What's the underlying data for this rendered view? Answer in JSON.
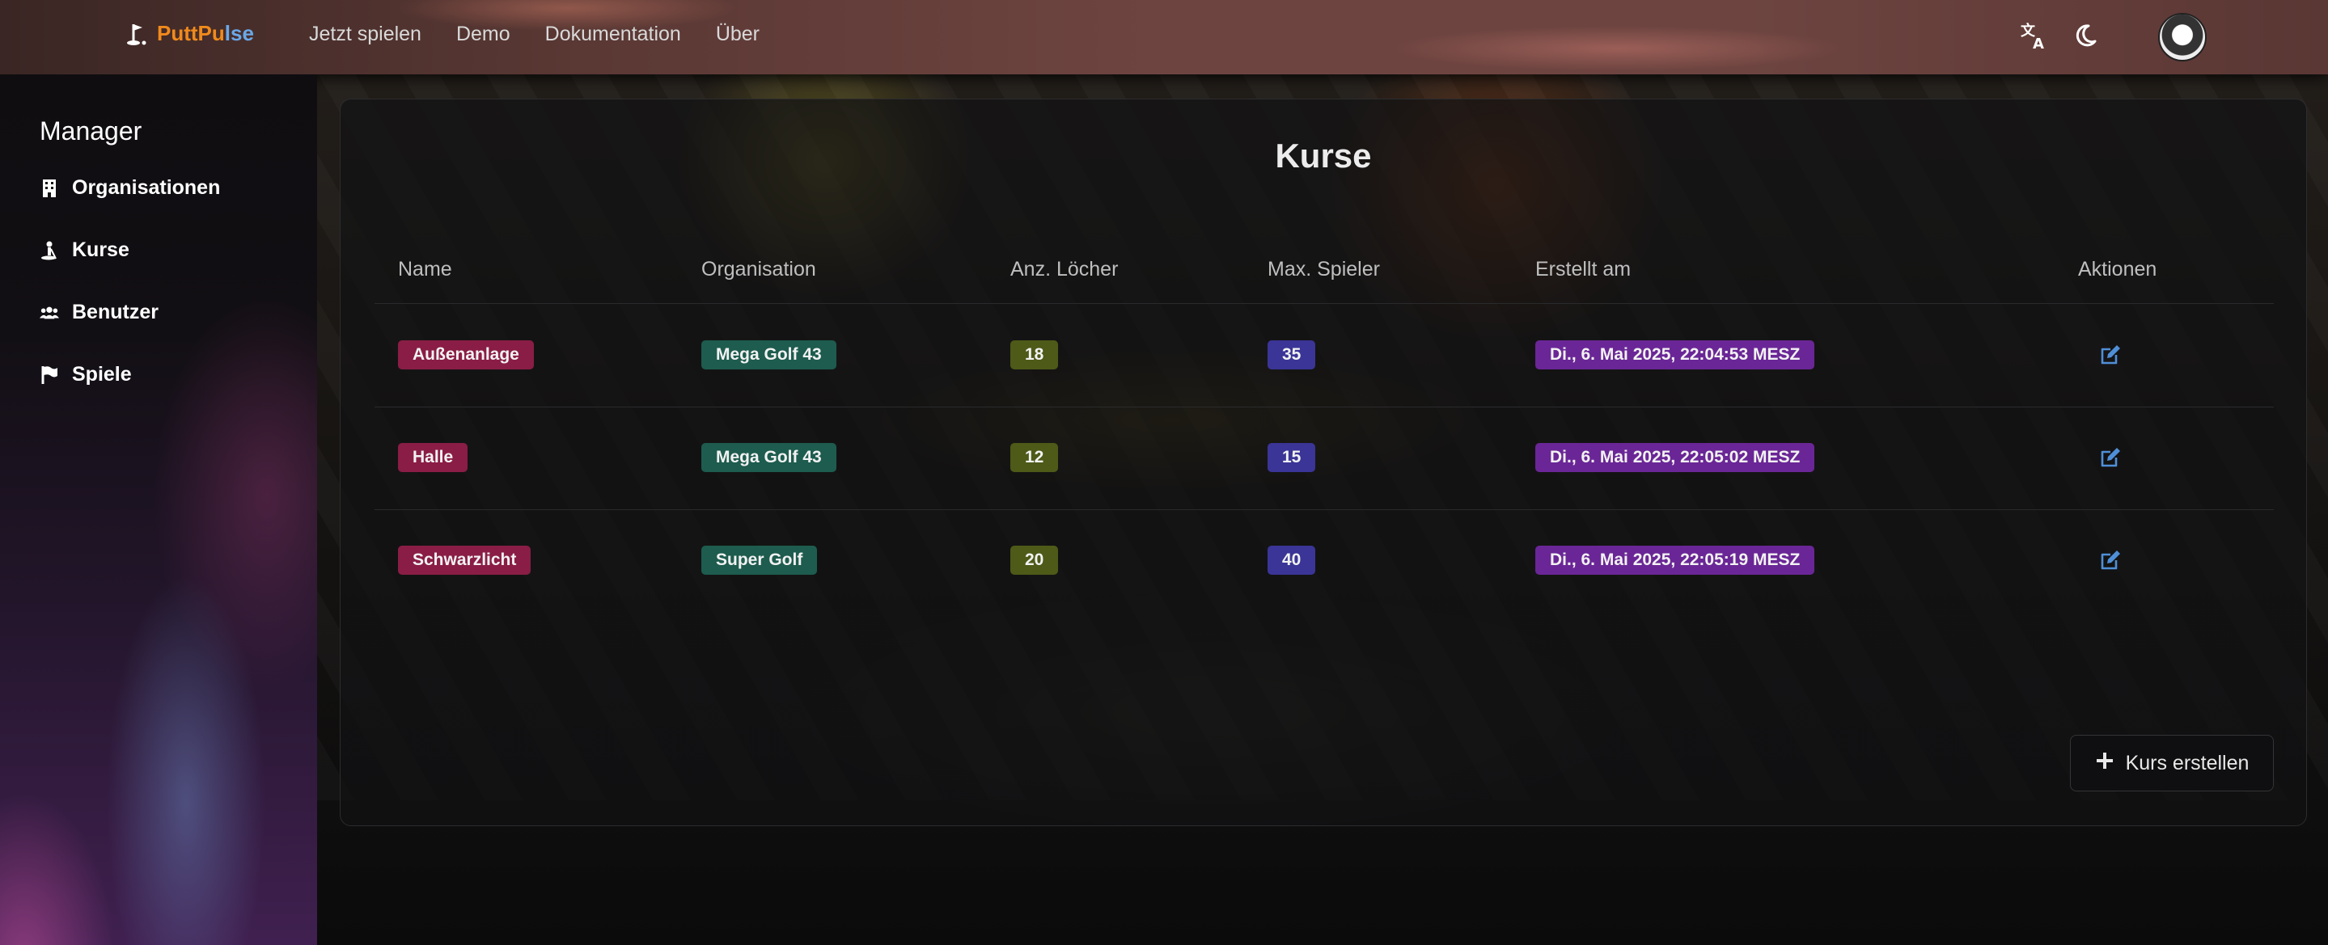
{
  "brand": {
    "name_part1": "PuttPu",
    "name_part2": "lse"
  },
  "nav": [
    {
      "label": "Jetzt spielen"
    },
    {
      "label": "Demo"
    },
    {
      "label": "Dokumentation"
    },
    {
      "label": "Über"
    }
  ],
  "header_icons": [
    "translate-icon",
    "moon-icon",
    "avatar"
  ],
  "sidebar": {
    "title": "Manager",
    "items": [
      {
        "label": "Organisationen",
        "icon": "building-icon"
      },
      {
        "label": "Kurse",
        "icon": "golfer-icon"
      },
      {
        "label": "Benutzer",
        "icon": "users-icon"
      },
      {
        "label": "Spiele",
        "icon": "flag-icon"
      }
    ]
  },
  "main": {
    "title": "Kurse",
    "columns": [
      "Name",
      "Organisation",
      "Anz. Löcher",
      "Max. Spieler",
      "Erstellt am",
      "Aktionen"
    ],
    "rows": [
      {
        "name": "Außenanlage",
        "organisation": "Mega Golf 43",
        "holes": "18",
        "players": "35",
        "created": "Di., 6. Mai 2025, 22:04:53 MESZ"
      },
      {
        "name": "Halle",
        "organisation": "Mega Golf 43",
        "holes": "12",
        "players": "15",
        "created": "Di., 6. Mai 2025, 22:05:02 MESZ"
      },
      {
        "name": "Schwarzlicht",
        "organisation": "Super Golf",
        "holes": "20",
        "players": "40",
        "created": "Di., 6. Mai 2025, 22:05:19 MESZ"
      }
    ],
    "create_button": "Kurs erstellen"
  },
  "colors": {
    "brand_orange": "#f08a1c",
    "brand_blue": "#6aa8e8",
    "badge_name": "#8a1d45",
    "badge_org": "#1d5c4e",
    "badge_holes": "#4d5a18",
    "badge_players": "#3a3596",
    "badge_date": "#6a2696",
    "edit_icon": "#4f8fd8"
  }
}
